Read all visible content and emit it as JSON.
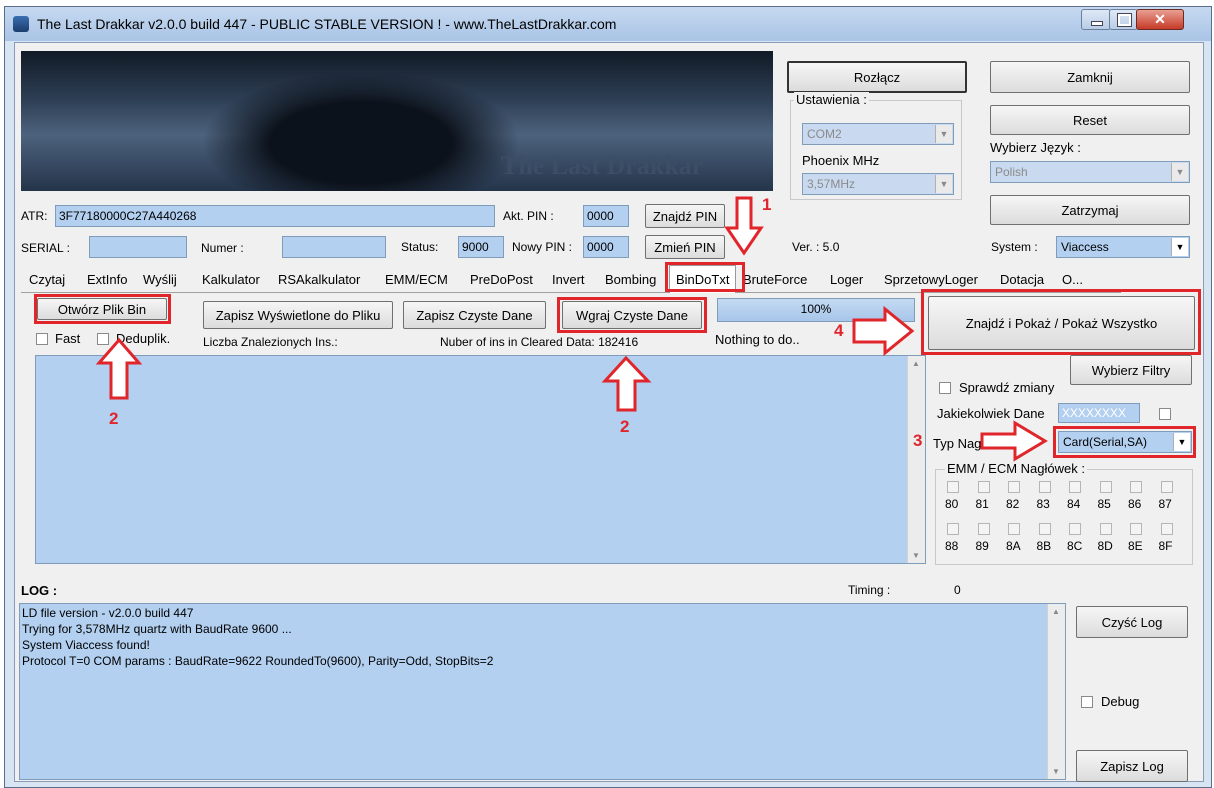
{
  "window": {
    "title": "The Last Drakkar v2.0.0 build 447  -  PUBLIC STABLE VERSION ! - www.TheLastDrakkar.com"
  },
  "banner": {
    "text": "The Last Drakkar"
  },
  "top_buttons": {
    "disconnect": "Rozłącz",
    "close": "Zamknij",
    "reset": "Reset",
    "stop": "Zatrzymaj",
    "find_pin": "Znajdź PIN",
    "change_pin": "Zmień PIN"
  },
  "settings": {
    "group_label": "Ustawienia :",
    "port": "COM2",
    "mhz_label": "Phoenix MHz",
    "mhz": "3,57MHz",
    "language_label": "Wybierz Język :",
    "language": "Polish"
  },
  "card": {
    "atr_label": "ATR:",
    "atr": "3F77180000C27A440268",
    "serial_label": "SERIAL :",
    "serial": "",
    "numer_label": "Numer :",
    "numer": "",
    "akt_pin_label": "Akt. PIN :",
    "akt_pin": "0000",
    "status_label": "Status:",
    "status": "9000",
    "nowy_pin_label": "Nowy PIN :",
    "nowy_pin": "0000",
    "ver": "Ver. : 5.0",
    "system_label": "System :",
    "system": "Viaccess"
  },
  "tabs": [
    "Czytaj",
    "ExtInfo",
    "Wyślij",
    "Kalkulator",
    "RSAkalkulator",
    "EMM/ECM",
    "PreDoPost",
    "Invert",
    "Bombing",
    "BinDoTxt",
    "BruteForce",
    "Loger",
    "SprzetowyLoger",
    "Dotacja",
    "O..."
  ],
  "bindotxt": {
    "open_bin": "Otwórz Plik Bin",
    "save_shown": "Zapisz Wyświetlone do Pliku",
    "save_clean": "Zapisz Czyste Dane",
    "load_clean": "Wgraj Czyste Dane",
    "progress": "100%",
    "progress_value": 1.0,
    "find_show": "Znajdź i Pokaż / Pokaż Wszystko",
    "fast": "Fast",
    "dedup": "Deduplik.",
    "count_label": "Liczba Znalezionych Ins.:",
    "cleared_label": "Nuber of ins in Cleared Data: 182416",
    "status": "Nothing to do..",
    "choose_filters": "Wybierz Filtry",
    "check_changes": "Sprawdź zmiany",
    "any_data_label": "Jakiekolwiek Dane",
    "any_data": "XXXXXXXX",
    "header_type_label": "Typ Nagłówka :",
    "header_type": "Card(Serial,SA)",
    "emm_group": "EMM / ECM Nagłówek :",
    "emm_row1": [
      "80",
      "81",
      "82",
      "83",
      "84",
      "85",
      "86",
      "87"
    ],
    "emm_row2": [
      "88",
      "89",
      "8A",
      "8B",
      "8C",
      "8D",
      "8E",
      "8F"
    ]
  },
  "log": {
    "title": "LOG :",
    "timing_label": "Timing :",
    "timing": "0",
    "lines": [
      "LD file version - v2.0.0 build 447",
      "Trying for 3,578MHz quartz with BaudRate 9600 ...",
      "System Viaccess found!",
      "Protocol T=0 COM params : BaudRate=9622 RoundedTo(9600), Parity=Odd, StopBits=2"
    ],
    "clear": "Czyść Log",
    "debug": "Debug",
    "save": "Zapisz Log"
  },
  "annotations": [
    "1",
    "2",
    "2",
    "3",
    "4"
  ],
  "colors": {
    "annotation": "#e0252b",
    "field": "#b3d0f0"
  }
}
